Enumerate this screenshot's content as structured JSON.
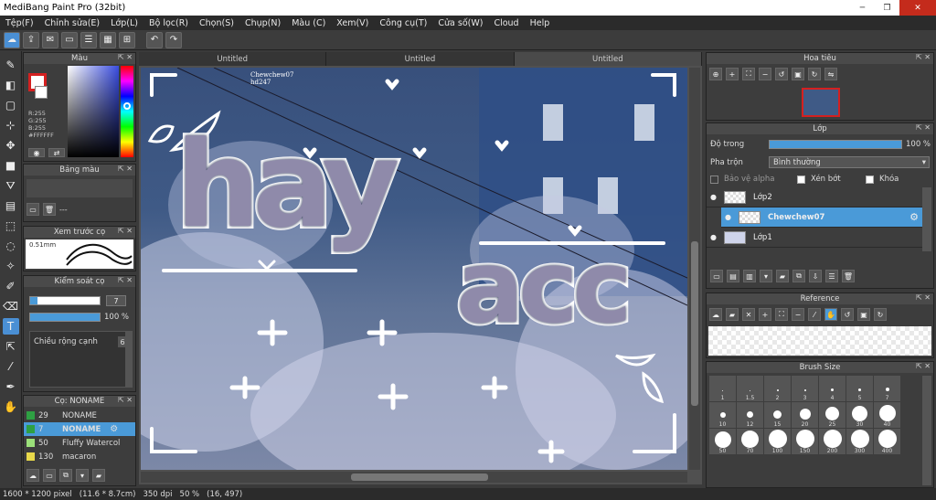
{
  "window": {
    "title": "MediBang Paint Pro (32bit)"
  },
  "menu": [
    "Tệp(F)",
    "Chỉnh sửa(E)",
    "Lớp(L)",
    "Bộ lọc(R)",
    "Chọn(S)",
    "Chụp(N)",
    "Màu (C)",
    "Xem(V)",
    "Công cụ(T)",
    "Cửa số(W)",
    "Cloud",
    "Help"
  ],
  "tabs": [
    {
      "label": "Untitled"
    },
    {
      "label": "Untitled"
    },
    {
      "label": "Untitled"
    }
  ],
  "color_panel": {
    "title": "Màu",
    "r": "R:255",
    "g": "G:255",
    "b": "B:255",
    "hex": "#FFFFFF"
  },
  "palette_panel": {
    "title": "Bảng màu",
    "value": "---"
  },
  "preview_panel": {
    "title": "Xem trước cọ",
    "size": "0.51mm"
  },
  "brush_ctrl": {
    "title": "Kiểm soát cọ",
    "size": "7",
    "opacity": "100 %",
    "edge_label": "Chiều rộng cạnh",
    "edge_value": "6"
  },
  "brush_list": {
    "title": "Cọ: NONAME",
    "items": [
      {
        "size": "29",
        "name": "NONAME",
        "color": "#2ea043"
      },
      {
        "size": "7",
        "name": "NONAME",
        "color": "#2ea043"
      },
      {
        "size": "50",
        "name": "Fluffy Watercol",
        "color": "#9be07a"
      },
      {
        "size": "130",
        "name": "macaron",
        "color": "#e8d84a"
      }
    ]
  },
  "navigator": {
    "title": "Hoa tiêu"
  },
  "layer_panel": {
    "title": "Lớp",
    "opacity_label": "Độ trong",
    "opacity_value": "100 %",
    "blend_label": "Pha trộn",
    "blend_value": "Bình thường",
    "protect_alpha": "Bảo vệ alpha",
    "clipping": "Xén bớt",
    "lock": "Khóa",
    "layers": [
      {
        "name": "Lớp2"
      },
      {
        "name": "Chewchew07"
      },
      {
        "name": "Lớp1"
      }
    ]
  },
  "reference": {
    "title": "Reference"
  },
  "brush_size": {
    "title": "Brush Size",
    "sizes": [
      "1",
      "1.5",
      "2",
      "3",
      "4",
      "5",
      "7",
      "10",
      "12",
      "15",
      "20",
      "25",
      "30",
      "40",
      "50",
      "70",
      "100",
      "150",
      "200",
      "300",
      "400"
    ]
  },
  "canvas_text": {
    "credit1": "Chewchew07",
    "credit2": "hd247",
    "line1": "hay",
    "line2": "acc"
  },
  "status": {
    "size_px": "1600 * 1200 pixel",
    "size_cm": "(11.6 * 8.7cm)",
    "dpi": "350 dpi",
    "zoom": "50 %",
    "coords": "(16, 497)"
  },
  "colors": {
    "accent": "#4a9ad8",
    "panel": "#3d3d3d",
    "close": "#c42b1c"
  }
}
